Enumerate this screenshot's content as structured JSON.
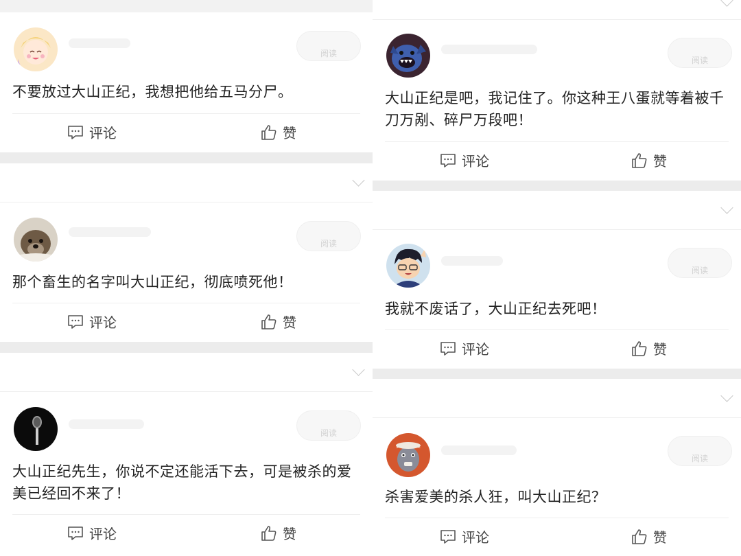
{
  "actions": {
    "comment": "评论",
    "like": "赞"
  },
  "read_label": "阅读",
  "left_posts": [
    {
      "text": "不要放过大山正纪，我想把他给五马分尸。",
      "avatar": "anime-girl-avatar"
    },
    {
      "text": "那个畜生的名字叫大山正纪，彻底喷死他！",
      "avatar": "otter-avatar"
    },
    {
      "text": "大山正纪先生，你说不定还能活下去，可是被杀的爱美已经回不来了！",
      "avatar": "microphone-avatar"
    }
  ],
  "right_posts": [
    {
      "text": "大山正纪是吧，我记住了。你这种王八蛋就等着被千刀万剐、碎尸万段吧！",
      "avatar": "blue-monster-avatar"
    },
    {
      "text": "我就不废话了，大山正纪去死吧！",
      "avatar": "cartoon-boy-avatar"
    },
    {
      "text": "杀害爱美的杀人狂，叫大山正纪？",
      "avatar": "cartoon-cat-avatar"
    }
  ]
}
